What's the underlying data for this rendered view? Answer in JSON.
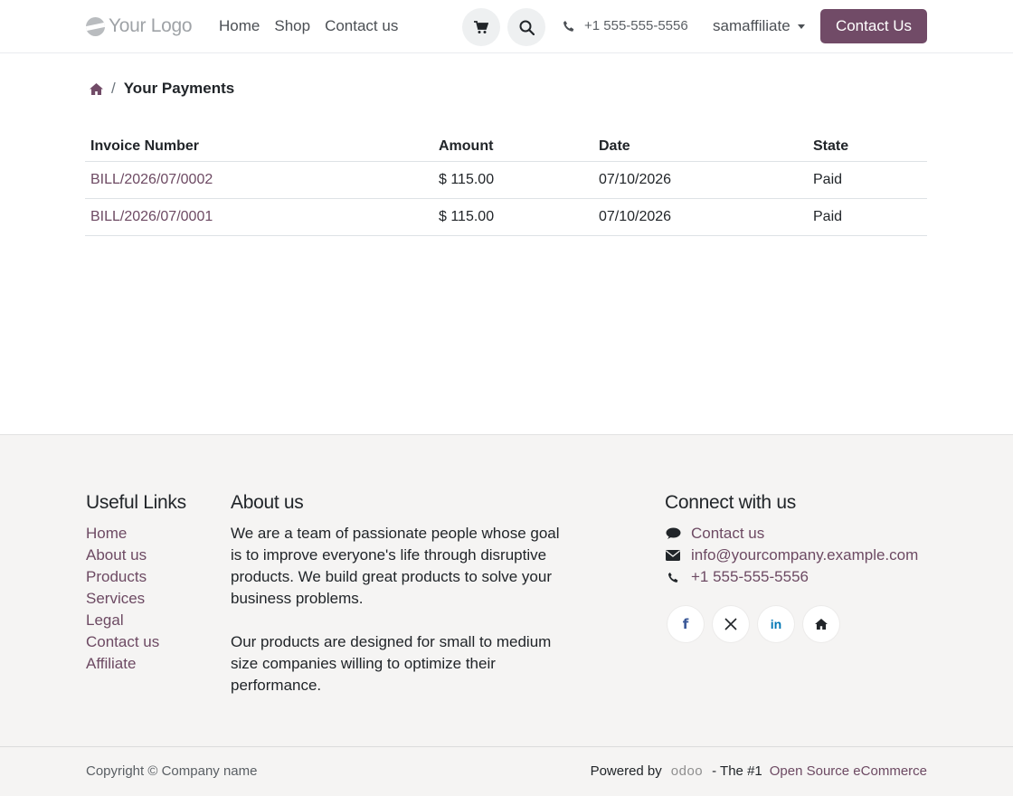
{
  "header": {
    "logo_text": "Your Logo",
    "nav": [
      "Home",
      "Shop",
      "Contact us"
    ],
    "phone": "+1 555-555-5556",
    "user": "samaffiliate",
    "cta": "Contact Us"
  },
  "breadcrumb": {
    "current": "Your Payments"
  },
  "table": {
    "headers": [
      "Invoice Number",
      "Amount",
      "Date",
      "State"
    ],
    "rows": [
      [
        "BILL/2026/07/0002",
        "$ 115.00",
        "07/10/2026",
        "Paid"
      ],
      [
        "BILL/2026/07/0001",
        "$ 115.00",
        "07/10/2026",
        "Paid"
      ]
    ]
  },
  "footer": {
    "useful_links_title": "Useful Links",
    "useful_links": [
      "Home",
      "About us",
      "Products",
      "Services",
      "Legal",
      "Contact us",
      "Affiliate"
    ],
    "about_title": "About us",
    "about_p1": "We are a team of passionate people whose goal is to improve everyone's life through disruptive products. We build great products to solve your business problems.",
    "about_p2": "Our products are designed for small to medium size companies willing to optimize their performance.",
    "connect_title": "Connect with us",
    "connect_contact": "Contact us",
    "connect_email": "info@yourcompany.example.com",
    "connect_phone": "+1 555-555-5556",
    "copyright": "Copyright © Company name",
    "powered_by": "Powered by",
    "odoo": "odoo",
    "powered_dash": "- The #1",
    "powered_link": "Open Source eCommerce"
  },
  "colors": {
    "brand": "#714b67",
    "link": "#6d4a63",
    "footer_bg": "#f5f4f3"
  }
}
